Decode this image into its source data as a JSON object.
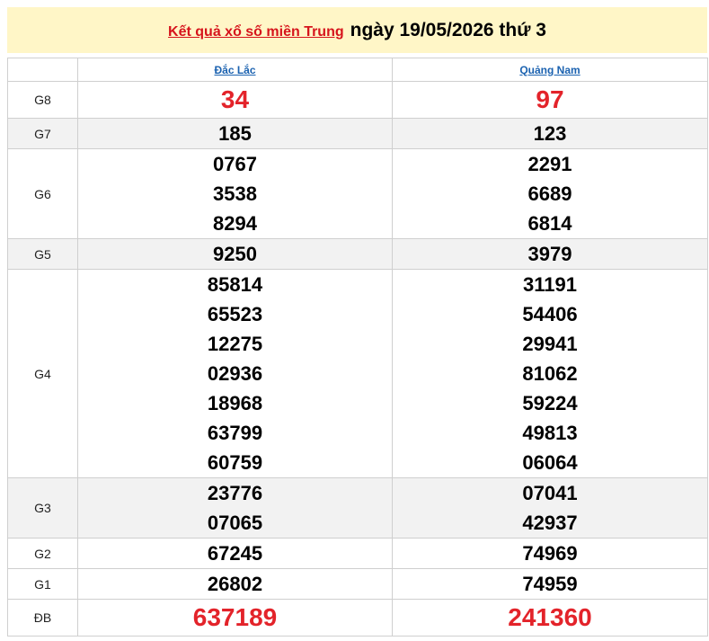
{
  "header": {
    "title_link": "Kết quả xổ số miền Trung",
    "date_text": "ngày 19/05/2026 thứ 3"
  },
  "colors": {
    "header_bg": "#fff6c7",
    "accent_red": "#e3232a",
    "link_blue": "#1b62b0",
    "alt_row_bg": "#f2f2f2"
  },
  "provinces": [
    "Đắc Lắc",
    "Quảng Nam"
  ],
  "prizes": [
    {
      "label": "G8",
      "style": "red-big",
      "shaded": false,
      "values": [
        [
          "34"
        ],
        [
          "97"
        ]
      ]
    },
    {
      "label": "G7",
      "style": "normal",
      "shaded": true,
      "values": [
        [
          "185"
        ],
        [
          "123"
        ]
      ]
    },
    {
      "label": "G6",
      "style": "normal",
      "shaded": false,
      "values": [
        [
          "0767",
          "3538",
          "8294"
        ],
        [
          "2291",
          "6689",
          "6814"
        ]
      ]
    },
    {
      "label": "G5",
      "style": "normal",
      "shaded": true,
      "values": [
        [
          "9250"
        ],
        [
          "3979"
        ]
      ]
    },
    {
      "label": "G4",
      "style": "normal",
      "shaded": false,
      "values": [
        [
          "85814",
          "65523",
          "12275",
          "02936",
          "18968",
          "63799",
          "60759"
        ],
        [
          "31191",
          "54406",
          "29941",
          "81062",
          "59224",
          "49813",
          "06064"
        ]
      ]
    },
    {
      "label": "G3",
      "style": "normal",
      "shaded": true,
      "values": [
        [
          "23776",
          "07065"
        ],
        [
          "07041",
          "42937"
        ]
      ]
    },
    {
      "label": "G2",
      "style": "normal",
      "shaded": false,
      "values": [
        [
          "67245"
        ],
        [
          "74969"
        ]
      ]
    },
    {
      "label": "G1",
      "style": "normal",
      "shaded": false,
      "values": [
        [
          "26802"
        ],
        [
          "74959"
        ]
      ]
    },
    {
      "label": "ĐB",
      "style": "red-huge",
      "shaded": false,
      "values": [
        [
          "637189"
        ],
        [
          "241360"
        ]
      ]
    }
  ]
}
